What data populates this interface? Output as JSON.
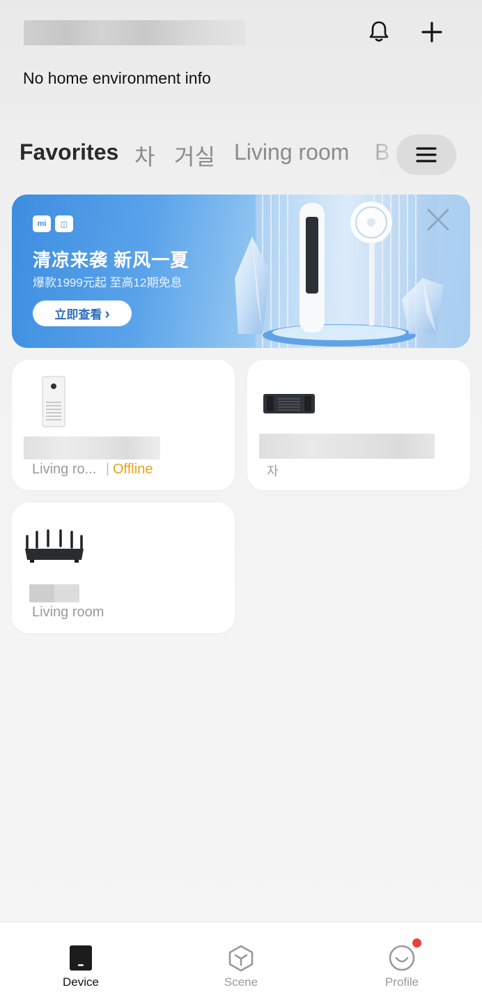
{
  "header": {
    "home_name": "",
    "env_info": "No home environment info"
  },
  "tabs": [
    {
      "label": "Favorites",
      "active": true
    },
    {
      "label": "차",
      "active": false
    },
    {
      "label": "거실",
      "active": false
    },
    {
      "label": "Living room",
      "active": false
    },
    {
      "label": "B",
      "active": false
    }
  ],
  "banner": {
    "logos": [
      "mi",
      "◫"
    ],
    "title": "清凉来袭  新风一夏",
    "subtitle": "爆款1999元起 至高12期免息",
    "button_label": "立即查看",
    "button_chevron": "›"
  },
  "devices": [
    {
      "name": "",
      "room": "Living ro...",
      "separator": "|",
      "status": "Offline",
      "status_color": "#e8a21a",
      "icon": "air-purifier"
    },
    {
      "name": "",
      "room": "자",
      "status": "",
      "icon": "ir-remote-hub"
    },
    {
      "name": "",
      "room": "Living room",
      "status": "",
      "icon": "wifi-router"
    }
  ],
  "bottom_nav": [
    {
      "label": "Device",
      "icon": "device-icon",
      "active": true
    },
    {
      "label": "Scene",
      "icon": "scene-cube-icon",
      "active": false
    },
    {
      "label": "Profile",
      "icon": "profile-smile-icon",
      "active": false,
      "badge": true
    }
  ],
  "colors": {
    "accent_status_offline": "#e8a21a",
    "badge": "#e8413a",
    "banner_blue": "#3d8de0"
  }
}
